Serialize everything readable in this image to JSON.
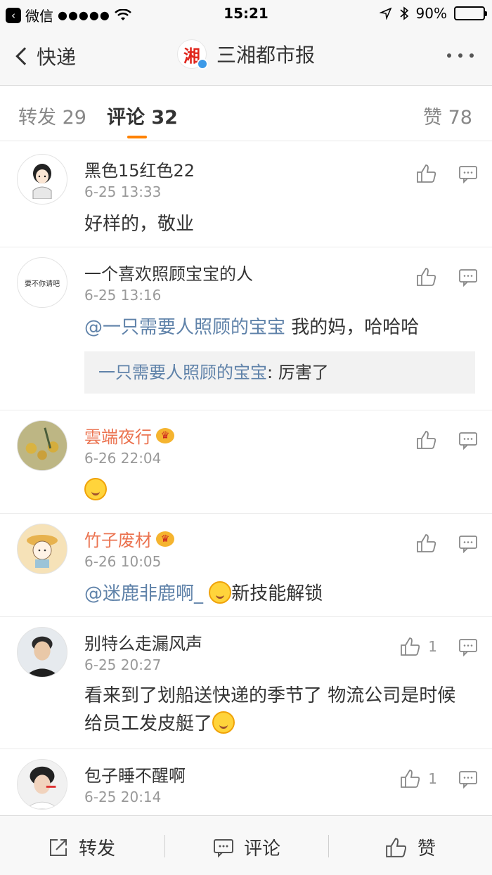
{
  "status": {
    "carrier": "微信",
    "signal": "●●●●●",
    "time": "15:21",
    "battery": "90%",
    "battery_level": 0.9
  },
  "nav": {
    "back_label": "快递",
    "logo_char": "湘",
    "title": "三湘都市报"
  },
  "tabs": {
    "repost": "转发 29",
    "comment": "评论 32",
    "like": "赞 78"
  },
  "comments": [
    {
      "name": "黑色15红色22",
      "time": "6-25 13:33",
      "text": "好样的，敬业",
      "likes": ""
    },
    {
      "name": "一个喜欢照顾宝宝的人",
      "avatar_text": "要不你请吧",
      "time": "6-25 13:16",
      "mention": "@一只需要人照顾的宝宝",
      "text": " 我的妈，哈哈哈",
      "quote_name": "一只需要人照顾的宝宝",
      "quote_text": ": 厉害了",
      "likes": ""
    },
    {
      "name": "雲端夜行",
      "time": "6-26 22:04",
      "likes": ""
    },
    {
      "name": "竹子废材",
      "time": "6-26 10:05",
      "mention": "@迷鹿非鹿啊_",
      "text": "新技能解锁",
      "likes": ""
    },
    {
      "name": "别特么走漏风声",
      "time": "6-25 20:27",
      "text": "看来到了划船送快递的季节了 物流公司是时候给员工发皮艇了",
      "likes": "1"
    },
    {
      "name": "包子睡不醒啊",
      "time": "6-25 20:14",
      "likes": "1"
    }
  ],
  "toolbar": {
    "repost": "转发",
    "comment": "评论",
    "like": "赞"
  },
  "colors": {
    "accent": "#ff8200",
    "mention": "#5f82a9",
    "vip_name": "#eb7350"
  }
}
